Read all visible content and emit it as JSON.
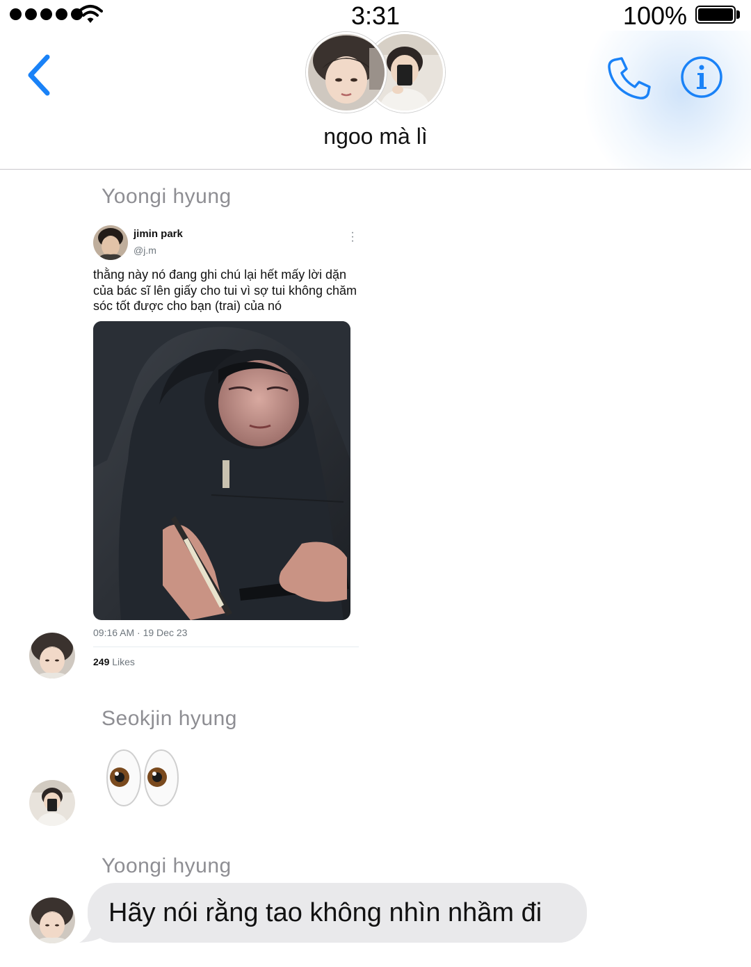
{
  "status_bar": {
    "time": "3:31",
    "battery": "100%"
  },
  "header": {
    "title": "ngoo mà lì"
  },
  "messages": [
    {
      "sender": "Yoongi hyung",
      "tweet": {
        "name": "jimin park",
        "handle": "@j.m",
        "text": "thằng này nó đang ghi chú lại hết mấy lời dặn của bác sĩ lên giấy cho tui vì sợ tui không chăm sóc tốt được cho bạn (trai) của nó",
        "time": "09:16 AM · 19 Dec 23",
        "likes_count": "249",
        "likes_label": "Likes"
      }
    },
    {
      "sender": "Seokjin hyung",
      "emoji": "👀"
    },
    {
      "sender": "Yoongi hyung",
      "text": "Hãy nói rằng tao không nhìn nhầm đi"
    }
  ],
  "icons": {
    "back": "chevron-left-icon",
    "call": "phone-icon",
    "info": "info-icon",
    "wifi": "wifi-icon"
  },
  "colors": {
    "accent": "#1a82f7",
    "bubble": "#e9e9eb",
    "sender_label": "#8e8e93"
  }
}
